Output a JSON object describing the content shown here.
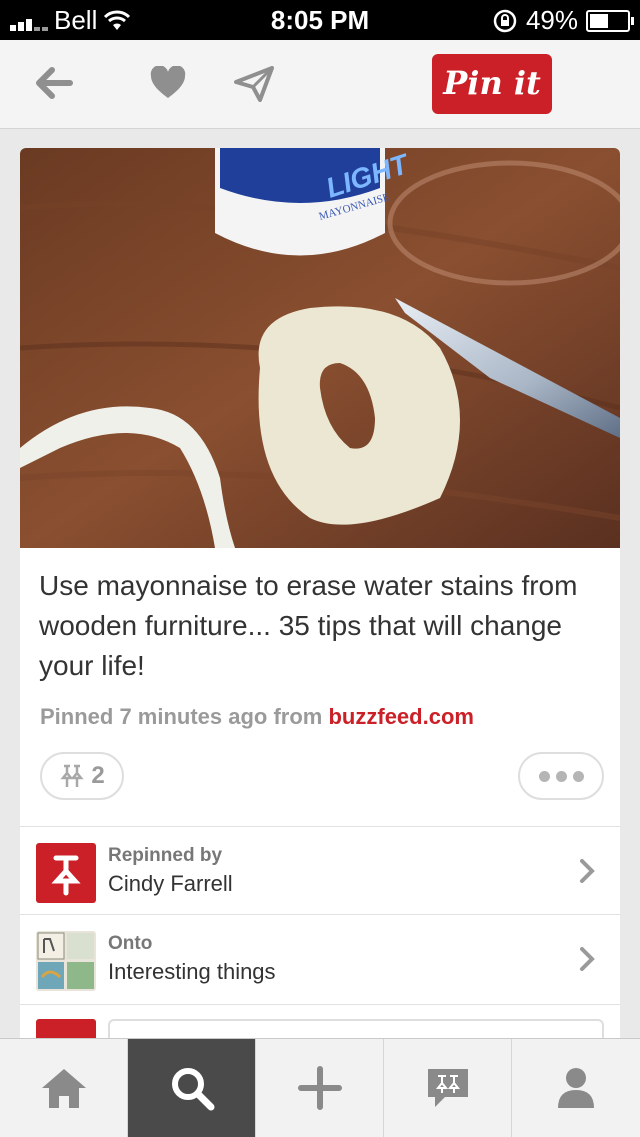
{
  "status_bar": {
    "carrier": "Bell",
    "time": "8:05 PM",
    "battery": "49%"
  },
  "header": {
    "pin_it_label": "Pin it"
  },
  "pin": {
    "description": "Use mayonnaise to erase water stains from wooden furniture... 35 tips that will change your life!",
    "meta_prefix": "Pinned 7 minutes ago from ",
    "source": "buzzfeed.com",
    "repin_count": "2",
    "image_text": {
      "brand": "LIGHT",
      "product": "MAYONNAISE"
    }
  },
  "repinned": {
    "label": "Repinned by",
    "value": "Cindy Farrell"
  },
  "onto": {
    "label": "Onto",
    "value": "Interesting things"
  },
  "tabs": [
    "home-icon",
    "search-icon",
    "add-icon",
    "news-icon",
    "profile-icon"
  ],
  "colors": {
    "accent": "#cb2027",
    "active_tab": "#4a4a4a"
  }
}
